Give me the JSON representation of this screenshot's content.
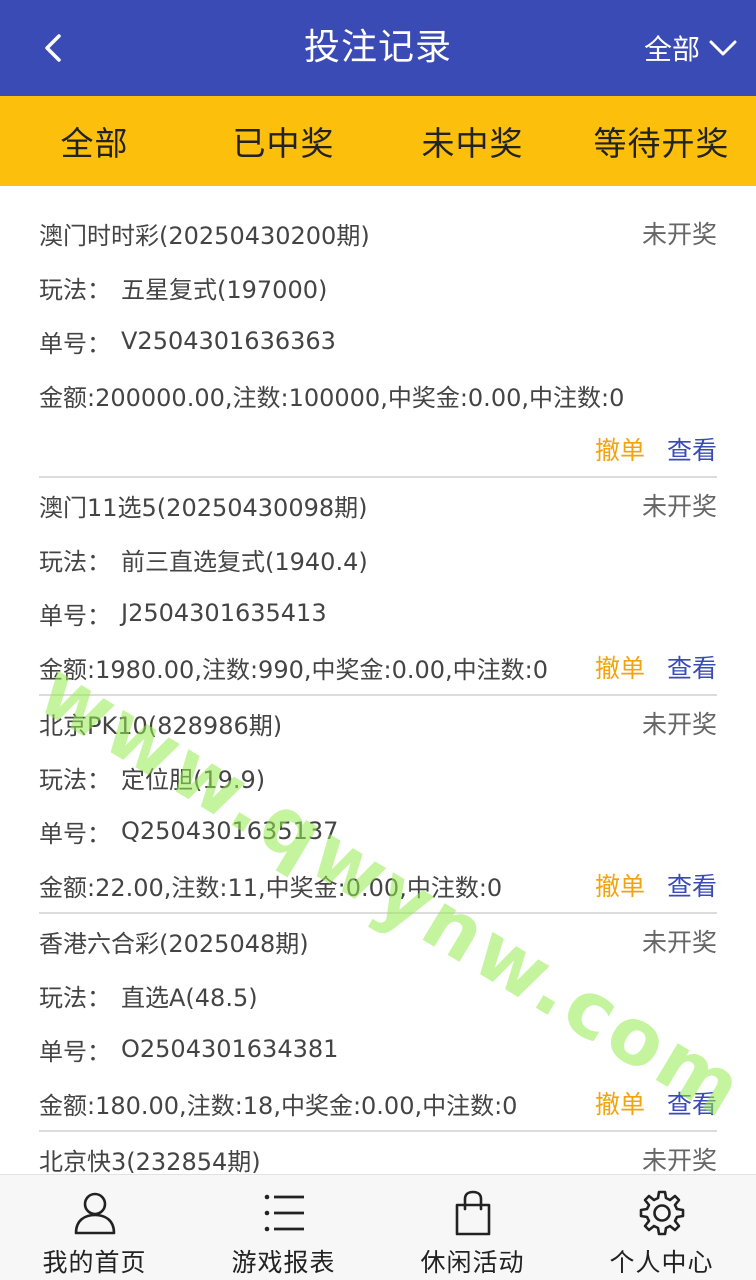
{
  "header": {
    "title": "投注记录",
    "filter_label": "全部"
  },
  "tabs": [
    {
      "label": "全部"
    },
    {
      "label": "已中奖"
    },
    {
      "label": "未中奖"
    },
    {
      "label": "等待开奖"
    }
  ],
  "labels": {
    "play": "玩法：",
    "order": "单号：",
    "cancel": "撤单",
    "view": "查看"
  },
  "records": [
    {
      "game": "澳门时时彩(20250430200期)",
      "status": "未开奖",
      "play": "五星复式(197000)",
      "order_no": "V2504301636363",
      "summary": "金额:200000.00,注数:100000,中奖金:0.00,中注数:0"
    },
    {
      "game": "澳门11选5(20250430098期)",
      "status": "未开奖",
      "play": "前三直选复式(1940.4)",
      "order_no": "J2504301635413",
      "summary": "金额:1980.00,注数:990,中奖金:0.00,中注数:0"
    },
    {
      "game": "北京PK10(828986期)",
      "status": "未开奖",
      "play": "定位胆(19.9)",
      "order_no": "Q2504301635137",
      "summary": "金额:22.00,注数:11,中奖金:0.00,中注数:0"
    },
    {
      "game": "香港六合彩(2025048期)",
      "status": "未开奖",
      "play": "直选A(48.5)",
      "order_no": "O2504301634381",
      "summary": "金额:180.00,注数:18,中奖金:0.00,中注数:0"
    },
    {
      "game": "北京快3(232854期)",
      "status": "未开奖"
    }
  ],
  "watermark": "www.qwynw.com",
  "bottom_nav": [
    {
      "label": "我的首页",
      "icon": "user-icon"
    },
    {
      "label": "游戏报表",
      "icon": "list-icon"
    },
    {
      "label": "休闲活动",
      "icon": "shopping-bag-icon"
    },
    {
      "label": "个人中心",
      "icon": "gear-icon"
    }
  ],
  "colors": {
    "header_bg": "#3b4bb5",
    "tabs_bg": "#fbbf0c",
    "cancel": "#f3a30c",
    "view": "#3b4bb5"
  }
}
